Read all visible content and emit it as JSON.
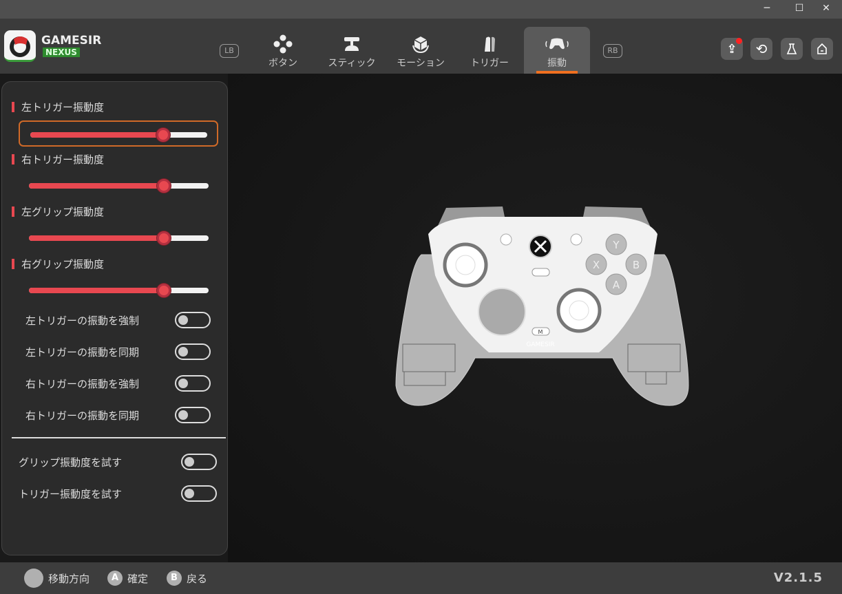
{
  "window": {
    "minimize": "─",
    "maximize": "☐",
    "close": "✕"
  },
  "brand": {
    "name": "GAMESIR",
    "sub": "NEXUS"
  },
  "bumpers": {
    "left": "LB",
    "right": "RB"
  },
  "tabs": [
    {
      "label": "ボタン",
      "icon": "dpad-icon"
    },
    {
      "label": "スティック",
      "icon": "stick-icon"
    },
    {
      "label": "モーション",
      "icon": "motion-icon"
    },
    {
      "label": "トリガー",
      "icon": "trigger-icon"
    },
    {
      "label": "振動",
      "icon": "vibration-icon",
      "active": true
    }
  ],
  "header_buttons": [
    "upload-icon",
    "reset-icon",
    "flask-icon",
    "home-icon"
  ],
  "sliders": [
    {
      "label": "左トリガー振動度",
      "value": 0.75
    },
    {
      "label": "右トリガー振動度",
      "value": 0.75
    },
    {
      "label": "左グリップ振動度",
      "value": 0.75
    },
    {
      "label": "右グリップ振動度",
      "value": 0.75
    }
  ],
  "toggles": [
    {
      "label": "左トリガーの振動を強制",
      "on": false
    },
    {
      "label": "左トリガーの振動を同期",
      "on": false
    },
    {
      "label": "右トリガーの振動を強制",
      "on": false
    },
    {
      "label": "右トリガーの振動を同期",
      "on": false
    }
  ],
  "tests": [
    {
      "label": "グリップ振動度を試す",
      "on": false
    },
    {
      "label": "トリガー振動度を試す",
      "on": false
    }
  ],
  "controller": {
    "buttons": {
      "y": "Y",
      "x": "X",
      "b": "B",
      "a": "A",
      "m": "M"
    },
    "logo": "GAMESIR"
  },
  "footer": {
    "move": "移動方向",
    "confirm_key": "A",
    "confirm": "確定",
    "back_key": "B",
    "back": "戻る",
    "version": "V2.1.5"
  },
  "colors": {
    "accent": "#e84850",
    "tab_underline": "#f07020",
    "focus": "#d06a28"
  }
}
